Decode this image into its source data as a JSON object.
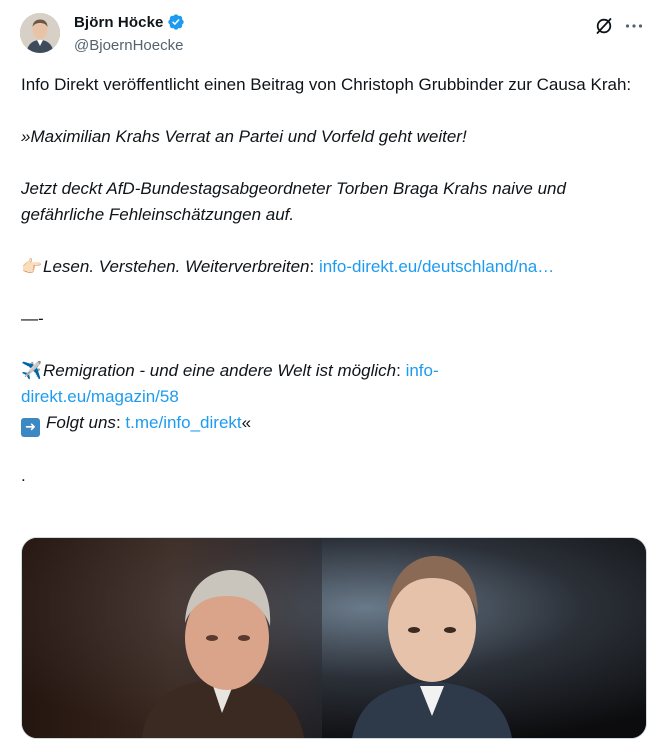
{
  "author": {
    "display_name": "Björn Höcke",
    "handle": "@BjoernHoecke",
    "verified_color": "#1d9bf0",
    "avatar_icon": "avatar-portrait"
  },
  "actions": {
    "grok_icon": "grok-icon",
    "more_icon": "more-dots-icon"
  },
  "tweet": {
    "line1": "Info Direkt veröffentlicht einen Beitrag von Christoph Grubbinder zur Causa Krah:",
    "quote1": "»Maximilian Krahs Verrat an Partei und Vorfeld geht weiter!",
    "quote2": "Jetzt deckt AfD-Bundestagsabgeordneter Torben Braga Krahs naive und gefährliche Fehleinschätzungen auf.",
    "read_emoji": "👉🏻",
    "read_text": "Lesen. Verstehen. Weiterverbreiten",
    "read_colon": ":",
    "read_link": "info-direkt.eu/deutschland/na…",
    "separator": "—-",
    "remig_emoji": "✈️",
    "remig_text": "Remigration - und eine andere Welt ist möglich",
    "remig_colon": ":",
    "remig_link_a": "info-",
    "remig_link_b": "direkt.eu/magazin/58",
    "follow_emoji": "➡️",
    "follow_text": "Folgt uns",
    "follow_colon": ":",
    "follow_link": "t.me/info_direkt",
    "follow_close": "«",
    "dot": "."
  },
  "colors": {
    "text": "#0f1419",
    "secondary": "#536471",
    "link": "#1d9bf0",
    "background": "#ffffff"
  }
}
